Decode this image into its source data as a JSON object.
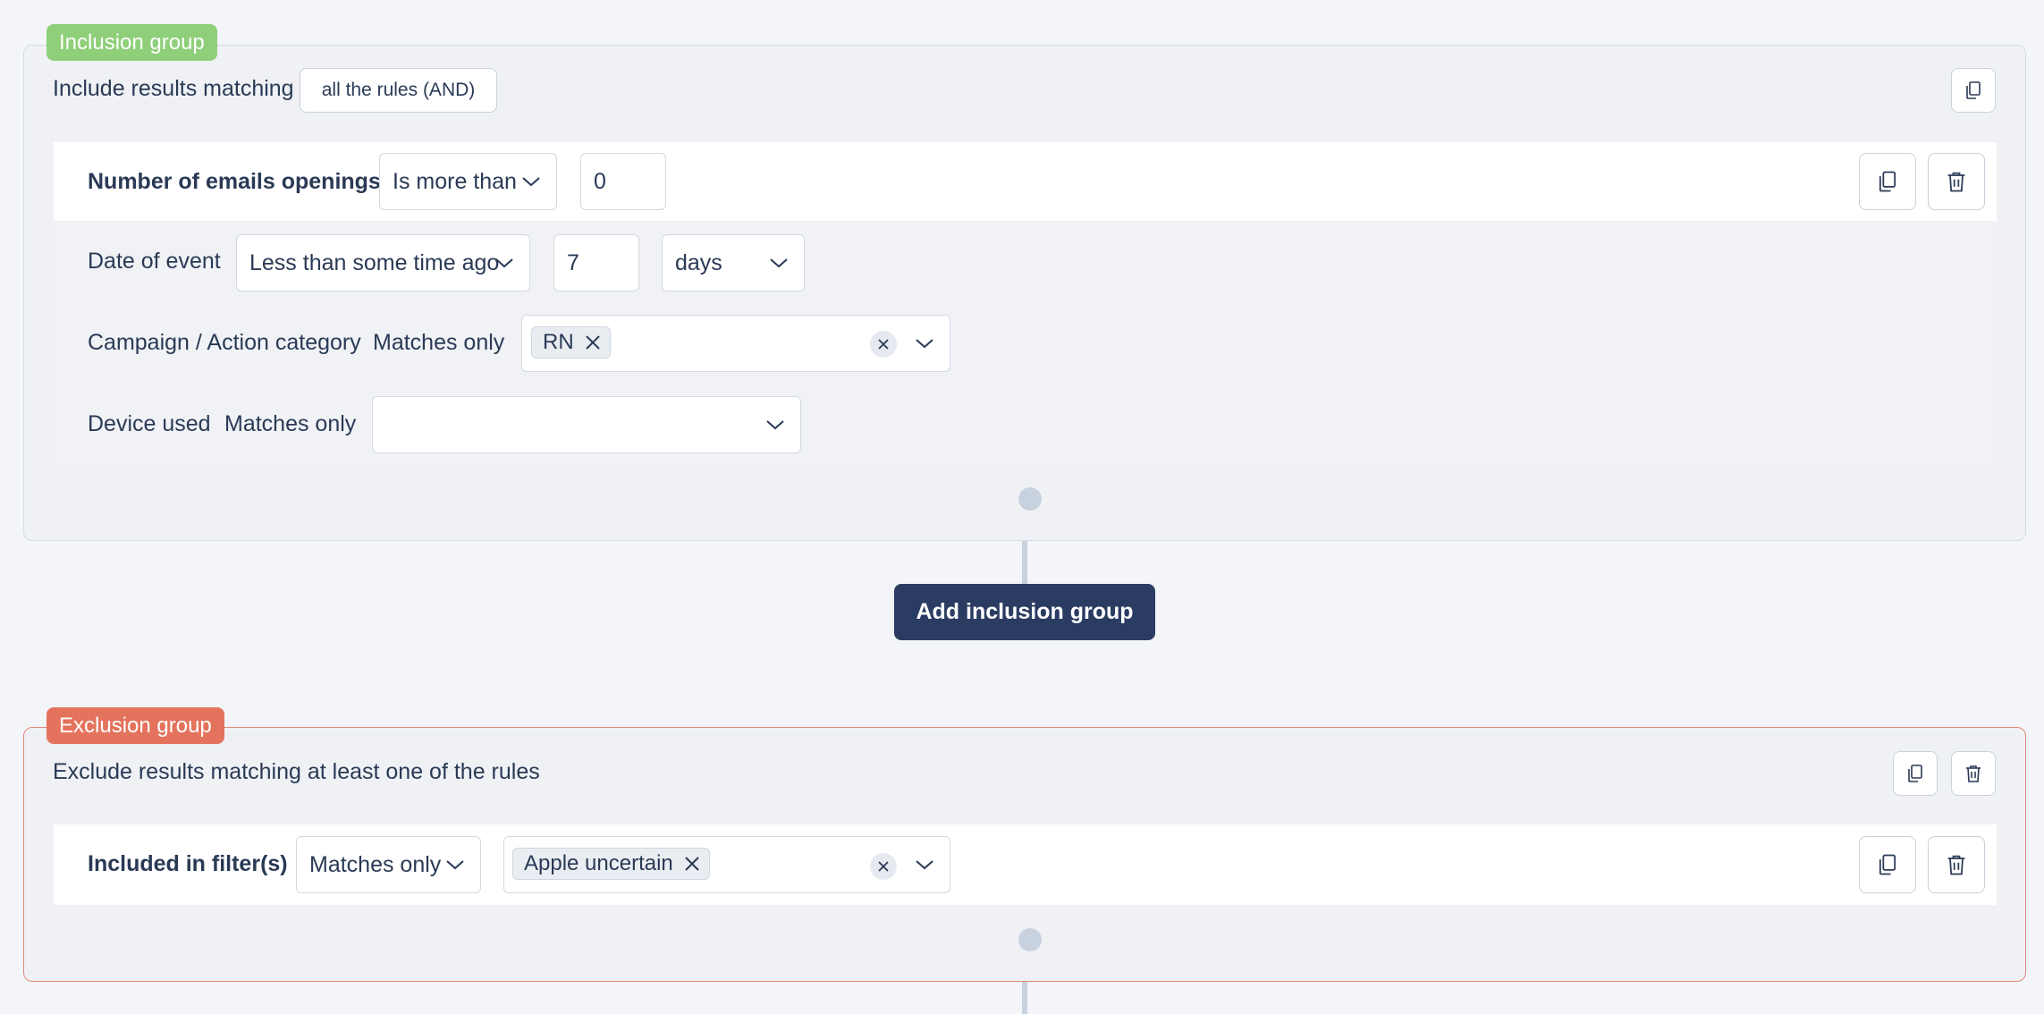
{
  "inclusion": {
    "badge": "Inclusion group",
    "matching_label": "Include results matching",
    "matching_mode": "all the rules (AND)",
    "rule": {
      "title": "Number of emails openings",
      "operator": "Is more than",
      "value": "0",
      "conditions": {
        "date": {
          "label": "Date of event",
          "operator": "Less than some time ago",
          "value": "7",
          "unit": "days"
        },
        "campaign": {
          "label": "Campaign / Action category",
          "operator": "Matches only",
          "tags": [
            "RN"
          ]
        },
        "device": {
          "label": "Device used",
          "operator": "Matches only",
          "value": ""
        }
      }
    }
  },
  "add_inclusion_label": "Add inclusion group",
  "exclusion": {
    "badge": "Exclusion group",
    "matching_label": "Exclude results matching at least one of the rules",
    "rule": {
      "title": "Included in filter(s)",
      "operator": "Matches only",
      "tags": [
        "Apple uncertain"
      ]
    }
  },
  "colors": {
    "inclusion_badge": "#8fcf7a",
    "exclusion_badge": "#e4735d",
    "exclusion_border": "#e08a78",
    "primary_button": "#2b3c62",
    "text": "#2a3a55"
  },
  "icons": {
    "copy": "copy-icon",
    "delete": "trash-icon",
    "dropdown": "chevron-down-icon",
    "remove_tag": "close-icon",
    "clear": "clear-icon"
  }
}
